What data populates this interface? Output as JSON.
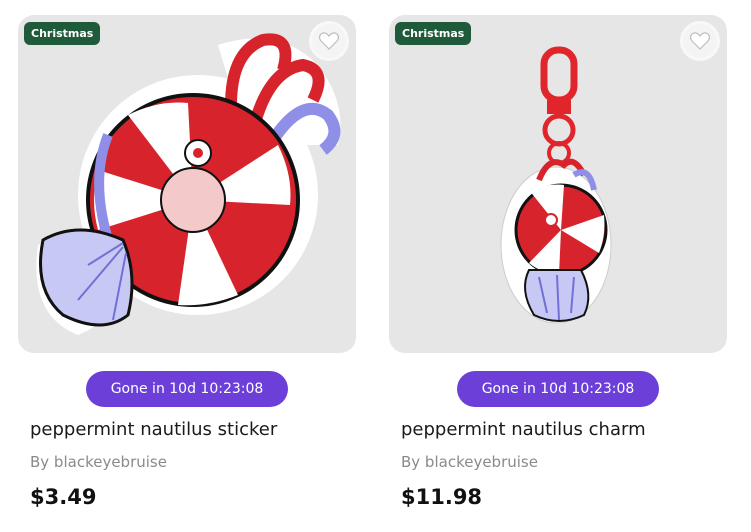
{
  "products": [
    {
      "tag": "Christmas",
      "image_icon": "peppermint-nautilus-sticker-image",
      "countdown": "Gone in 10d 10:23:08",
      "title": "peppermint nautilus sticker",
      "author": "By blackeyebruise",
      "price": "$3.49"
    },
    {
      "tag": "Christmas",
      "image_icon": "peppermint-nautilus-charm-image",
      "countdown": "Gone in 10d 10:23:08",
      "title": "peppermint nautilus charm",
      "author": "By blackeyebruise",
      "price": "$11.98"
    }
  ],
  "colors": {
    "tag_bg": "#1f5b3a",
    "timer_bg": "#6c3fd8",
    "card_bg": "#e6e6e6",
    "candy_red": "#d7242c",
    "candy_blue": "#8f8fe8"
  }
}
